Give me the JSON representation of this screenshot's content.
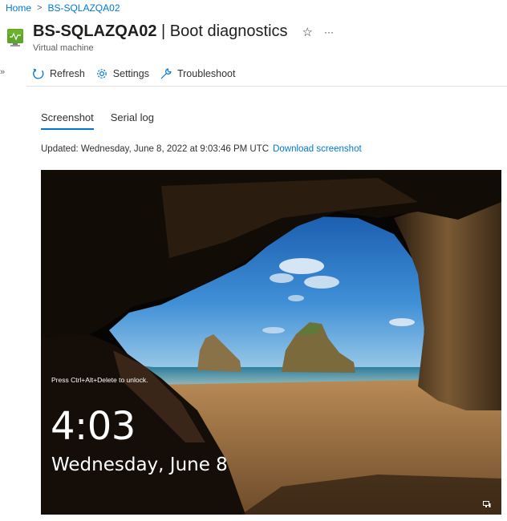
{
  "breadcrumb": {
    "home": "Home",
    "separator": ">",
    "current": "BS-SQLAZQA02"
  },
  "header": {
    "vm_name": "BS-SQLAZQA02",
    "title_separator": " | ",
    "page_name": "Boot diagnostics",
    "subtitle": "Virtual machine",
    "favorite_icon": "☆",
    "more_icon": "···"
  },
  "sidebar_toggle": "»",
  "toolbar": {
    "refresh": "Refresh",
    "settings": "Settings",
    "troubleshoot": "Troubleshoot"
  },
  "tabs": [
    {
      "label": "Screenshot",
      "active": true
    },
    {
      "label": "Serial log",
      "active": false
    }
  ],
  "updated": {
    "text": "Updated: Wednesday, June 8, 2022 at 9:03:46 PM UTC",
    "download_link": "Download screenshot"
  },
  "lock_screen": {
    "hint": "Press Ctrl+Alt+Delete to unlock.",
    "time": "4:03",
    "date": "Wednesday, June 8"
  },
  "colors": {
    "accent": "#0078d4",
    "vm_icon": "#5ea52c"
  }
}
